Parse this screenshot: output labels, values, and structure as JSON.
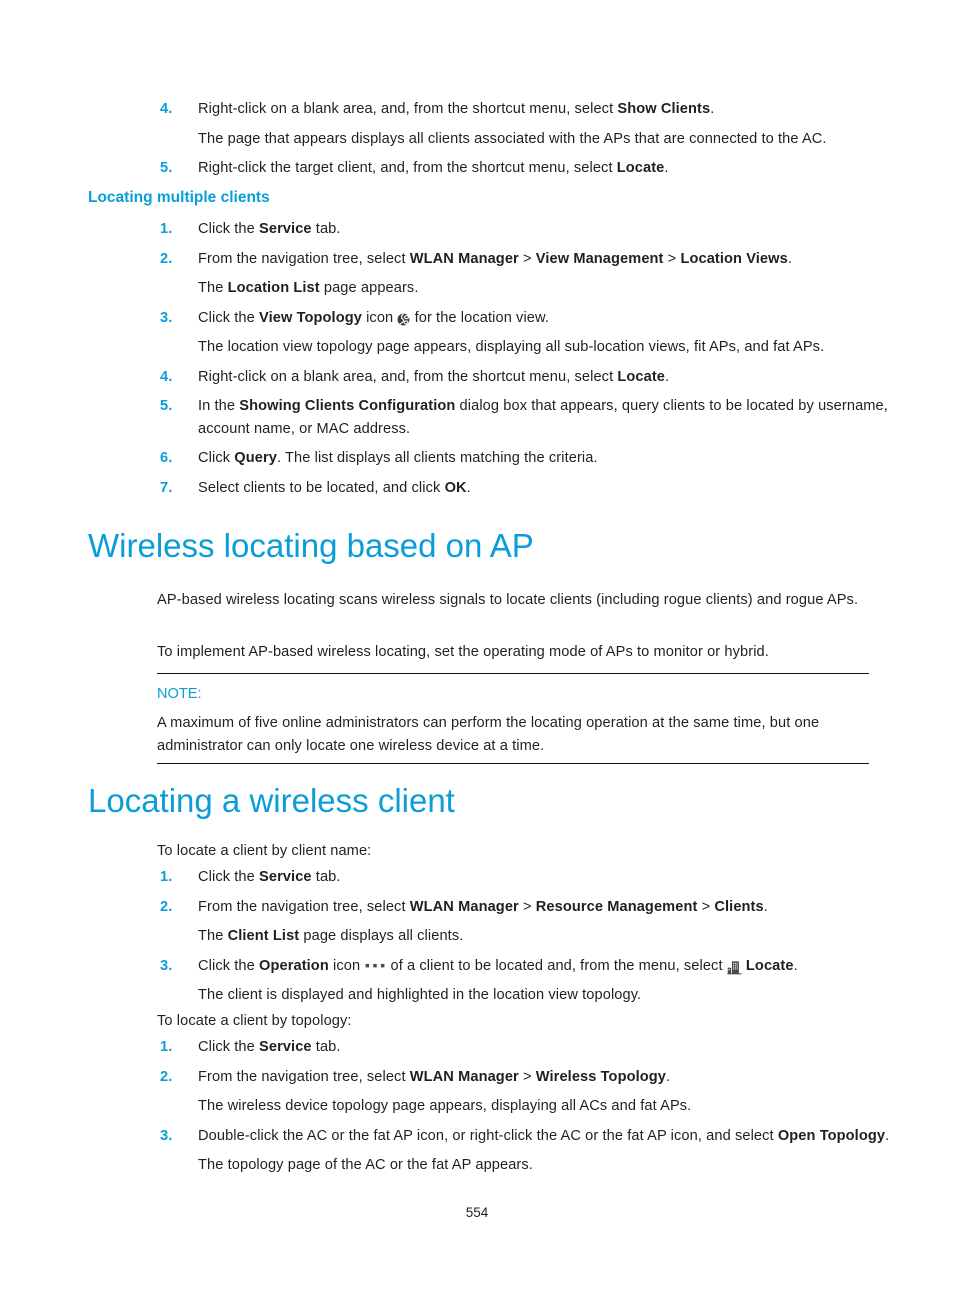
{
  "page": {
    "number": "554"
  },
  "top_steps": [
    {
      "num": "4.",
      "parts": [
        {
          "t": "Right-click on a blank area, and, from the shortcut menu, select ",
          "b": false
        },
        {
          "t": "Show Clients",
          "b": true
        },
        {
          "t": ".",
          "b": false
        }
      ],
      "sub": "The page that appears displays all clients associated with the APs that are connected to the AC."
    },
    {
      "num": "5.",
      "parts": [
        {
          "t": "Right-click the target client, and, from the shortcut menu, select ",
          "b": false
        },
        {
          "t": "Locate",
          "b": true
        },
        {
          "t": ".",
          "b": false
        }
      ]
    }
  ],
  "section_locating_multiple": {
    "heading": "Locating multiple clients",
    "steps": [
      {
        "num": "1.",
        "text_before": "Click the ",
        "bold": "Service",
        "text_after": " tab."
      },
      {
        "num": "2.",
        "text_before": "From the navigation tree, select ",
        "bold1": "WLAN Manager",
        "sep1": " > ",
        "bold2": "View Management",
        "sep2": " > ",
        "bold3": "Location Views",
        "text_after": ".",
        "sub_before": "The ",
        "sub_bold": "Location List",
        "sub_after": " page appears."
      },
      {
        "num": "3.",
        "text_before": "Click the ",
        "bold": "View Topology",
        "text_mid": " icon ",
        "icon": "view-topology-globe-icon",
        "text_after": " for the location view.",
        "sub": "The location view topology page appears, displaying all sub-location views, fit APs, and fat APs."
      },
      {
        "num": "4.",
        "text_before": "Right-click on a blank area, and, from the shortcut menu, select ",
        "bold": "Locate",
        "text_after": "."
      },
      {
        "num": "5.",
        "text_before": "In the ",
        "bold": "Showing Clients Configuration",
        "text_after": " dialog box that appears, query clients to be located by username, account name, or MAC address."
      },
      {
        "num": "6.",
        "text_before": "Click ",
        "bold": "Query",
        "text_after": ". The list displays all clients matching the criteria."
      },
      {
        "num": "7.",
        "text_before": "Select clients to be located, and click ",
        "bold": "OK",
        "text_after": "."
      }
    ]
  },
  "section_wireless_locating_ap": {
    "heading": "Wireless locating based on AP",
    "para1": "AP-based wireless locating scans wireless signals to locate clients (including rogue clients) and rogue APs.",
    "para2": "To implement AP-based wireless locating, set the operating mode of APs to monitor or hybrid.",
    "note": {
      "label": "NOTE:",
      "text": "A maximum of five online administrators can perform the locating operation at the same time, but one administrator can only locate one wireless device at a time."
    }
  },
  "section_locating_wireless_client": {
    "heading": "Locating a wireless client",
    "intro1": "To locate a client by client name:",
    "steps1": [
      {
        "num": "1.",
        "text_before": "Click the ",
        "bold": "Service",
        "text_after": " tab."
      },
      {
        "num": "2.",
        "text_before": "From the navigation tree, select ",
        "bold1": "WLAN Manager",
        "sep1": " > ",
        "bold2": "Resource Management",
        "sep2": " > ",
        "bold3": "Clients",
        "text_after": ".",
        "sub_before": "The ",
        "sub_bold": "Client List",
        "sub_after": " page displays all clients."
      },
      {
        "num": "3.",
        "text_before": "Click the ",
        "bold": "Operation",
        "text_mid": " icon ",
        "icon1": "operation-dots-icon",
        "text_mid2": " of a client to be located and, from the menu, select ",
        "icon2": "locate-building-icon",
        "bold2": "Locate",
        "text_after": ".",
        "sub": "The client is displayed and highlighted in the location view topology."
      }
    ],
    "intro2": "To locate a client by topology:",
    "steps2": [
      {
        "num": "1.",
        "text_before": "Click the ",
        "bold": "Service",
        "text_after": " tab."
      },
      {
        "num": "2.",
        "text_before": "From the navigation tree, select ",
        "bold1": "WLAN Manager",
        "sep1": " > ",
        "bold2": "Wireless Topology",
        "text_after": ".",
        "sub": "The wireless device topology page appears, displaying all ACs and fat APs."
      },
      {
        "num": "3.",
        "text_before": "Double-click the AC or the fat AP icon, or right-click the AC or the fat AP icon, and select ",
        "bold": "Open Topology",
        "text_after": ".",
        "sub": "The topology page of the AC or the fat AP appears."
      }
    ]
  },
  "colors": {
    "accent_blue": "#0b9dd9",
    "body_black": "#231f20"
  }
}
